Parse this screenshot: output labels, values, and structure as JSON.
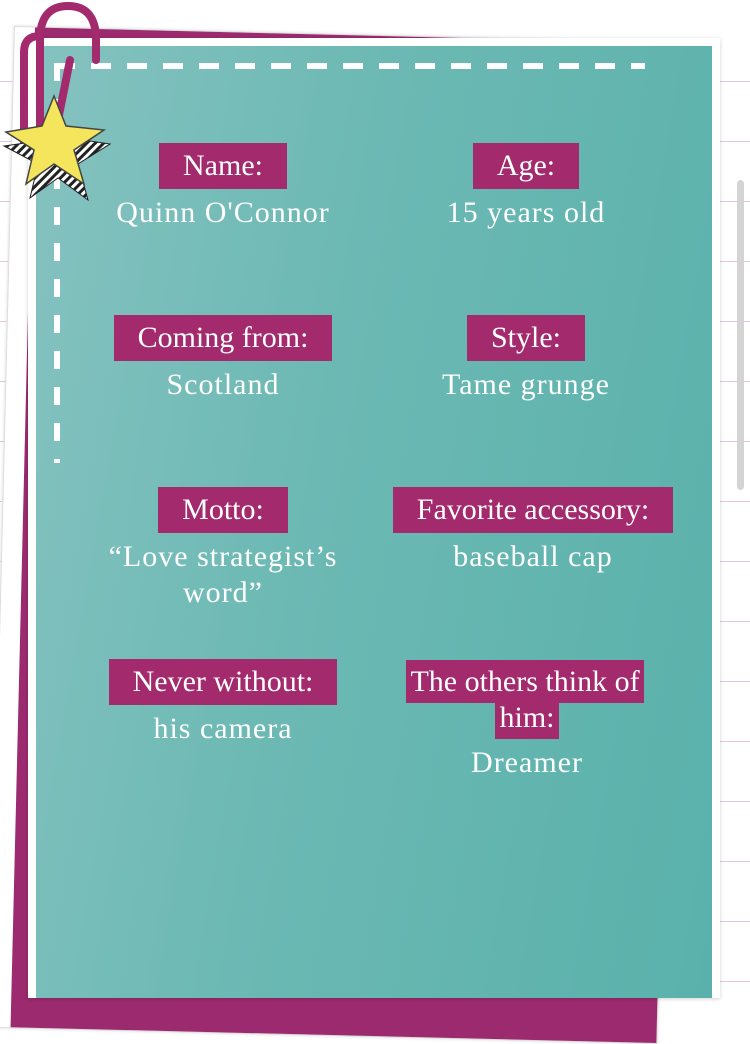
{
  "fields": [
    {
      "label": "Name:",
      "value": "Quinn O'Connor"
    },
    {
      "label": "Age:",
      "value": "15 years old"
    },
    {
      "label": "Coming from:",
      "value": "Scotland"
    },
    {
      "label": "Style:",
      "value": "Tame grunge"
    },
    {
      "label": "Motto:",
      "value": "“Love strategist’s word”"
    },
    {
      "label": "Favorite accessory:",
      "value": "baseball cap"
    },
    {
      "label": "Never without:",
      "value": "his camera"
    },
    {
      "label": "The others think of him:",
      "value": "Dreamer"
    }
  ],
  "colors": {
    "label_bg": "#a22a6d",
    "card_teal": "#6db9b4",
    "paper_lines": "#e3c6e0",
    "star": "#f4e55c"
  },
  "icons": [
    "paperclip-icon",
    "star-icon"
  ]
}
